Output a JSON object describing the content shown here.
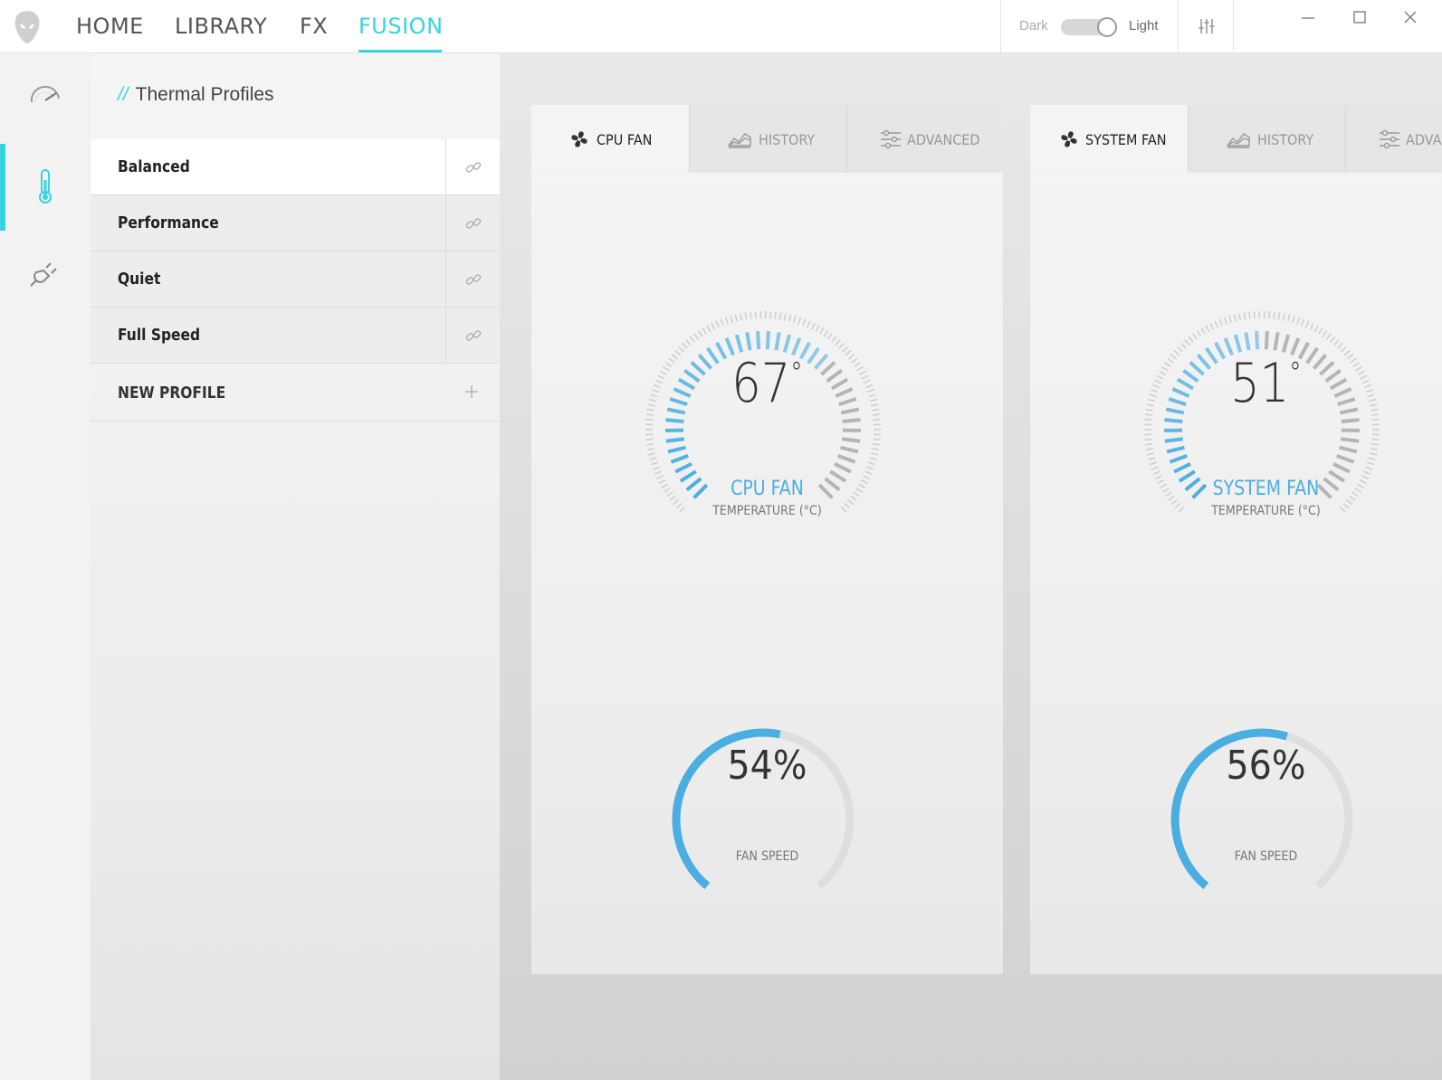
{
  "topnav": {
    "tabs": [
      "HOME",
      "LIBRARY",
      "FX",
      "FUSION"
    ],
    "active": "FUSION"
  },
  "theme": {
    "dark_label": "Dark",
    "light_label": "Light",
    "selected": "Light"
  },
  "rail": {
    "active": "thermal"
  },
  "profiles": {
    "title_prefix": "//",
    "title": "Thermal Profiles",
    "items": [
      {
        "label": "Balanced",
        "active": true
      },
      {
        "label": "Performance",
        "active": false
      },
      {
        "label": "Quiet",
        "active": false
      },
      {
        "label": "Full Speed",
        "active": false
      }
    ],
    "new_label": "NEW PROFILE"
  },
  "fans": [
    {
      "tabs": {
        "main": "CPU FAN",
        "history": "HISTORY",
        "advanced": "ADVANCED"
      },
      "temperature": "67",
      "degree_symbol": "°",
      "name": "CPU FAN",
      "temp_label": "TEMPERATURE (°C)",
      "speed": "54%",
      "speed_fraction": 0.54,
      "speed_label": "FAN SPEED",
      "temp_fraction": 0.67
    },
    {
      "tabs": {
        "main": "SYSTEM FAN",
        "history": "HISTORY",
        "advanced": "ADVAN"
      },
      "temperature": "51",
      "degree_symbol": "°",
      "name": "SYSTEM FAN",
      "temp_label": "TEMPERATURE (°C)",
      "speed": "56%",
      "speed_fraction": 0.56,
      "speed_label": "FAN SPEED",
      "temp_fraction": 0.51
    }
  ],
  "colors": {
    "accent": "#35d4e0",
    "gauge_blue": "#4aaee0",
    "gauge_gray": "#b5b5b5"
  }
}
